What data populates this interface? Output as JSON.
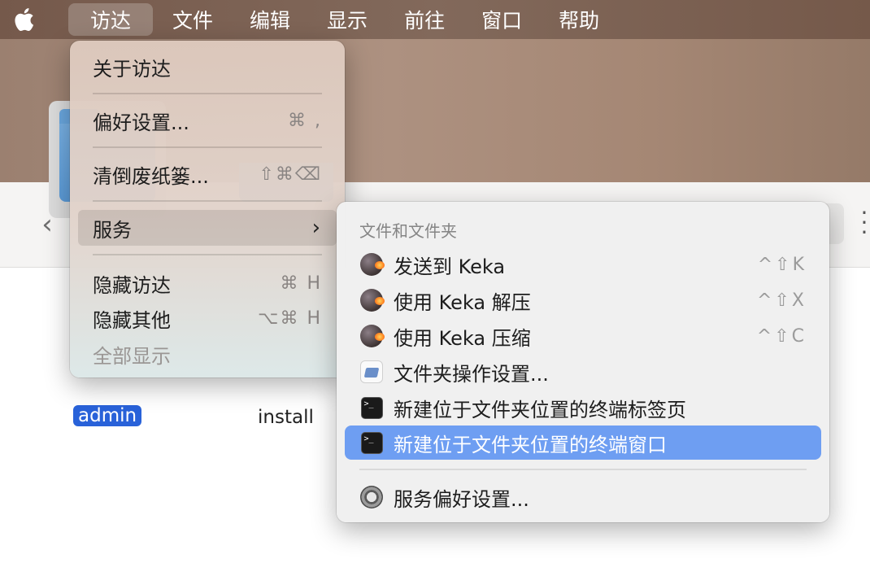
{
  "menubar": {
    "apple_icon": "apple-logo",
    "items": [
      {
        "label": "访达",
        "active": true
      },
      {
        "label": "文件"
      },
      {
        "label": "编辑"
      },
      {
        "label": "显示"
      },
      {
        "label": "前往"
      },
      {
        "label": "窗口"
      },
      {
        "label": "帮助"
      }
    ]
  },
  "finder_menu": {
    "items": [
      {
        "label": "关于访达",
        "shortcut": ""
      },
      {
        "label": "偏好设置...",
        "shortcut": "⌘ ,"
      },
      {
        "label": "清倒废纸篓...",
        "shortcut": "⇧⌘⌫"
      },
      {
        "label": "服务",
        "shortcut": "",
        "submenu_indicator": "›"
      },
      {
        "label": "隐藏访达",
        "shortcut": "⌘ H"
      },
      {
        "label": "隐藏其他",
        "shortcut": "⌥⌘ H"
      },
      {
        "label": "全部显示",
        "shortcut": "",
        "disabled": true
      }
    ]
  },
  "services_submenu": {
    "header": "文件和文件夹",
    "items": [
      {
        "label": "发送到 Keka",
        "shortcut": "^⇧K",
        "icon": "keka-icon"
      },
      {
        "label": "使用 Keka 解压",
        "shortcut": "^⇧X",
        "icon": "keka-icon"
      },
      {
        "label": "使用 Keka 压缩",
        "shortcut": "^⇧C",
        "icon": "keka-icon"
      },
      {
        "label": "文件夹操作设置...",
        "shortcut": "",
        "icon": "folder-actions-icon"
      },
      {
        "label": "新建位于文件夹位置的终端标签页",
        "shortcut": "",
        "icon": "terminal-icon"
      },
      {
        "label": "新建位于文件夹位置的终端窗口",
        "shortcut": "",
        "icon": "terminal-icon",
        "highlighted": true
      },
      {
        "label": "服务偏好设置...",
        "shortcut": "",
        "icon": "system-preferences-icon"
      }
    ]
  },
  "finder_window": {
    "back_glyph": "‹",
    "files": [
      {
        "label": "admin",
        "selected": true
      },
      {
        "label": "install",
        "selected": false
      }
    ]
  },
  "colors": {
    "menubar": "#7a5f51",
    "selection": "#2962d9",
    "submenu_highlight": "#6e9ef2"
  }
}
